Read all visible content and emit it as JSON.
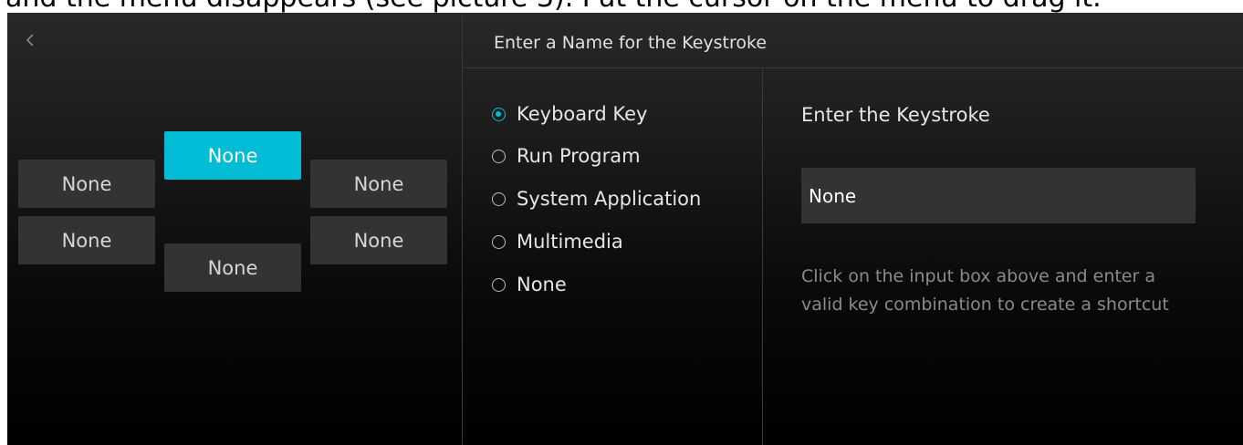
{
  "document": {
    "caption_fragment": "and the menu disappears (see picture 3). Put the cursor on the menu to drag it."
  },
  "left_panel": {
    "back_icon": "chevron-left-icon",
    "keys": [
      {
        "label": "None",
        "active": true
      },
      {
        "label": "None",
        "active": false
      },
      {
        "label": "None",
        "active": false
      },
      {
        "label": "None",
        "active": false
      },
      {
        "label": "None",
        "active": false
      },
      {
        "label": "None",
        "active": false
      }
    ]
  },
  "header": {
    "title": "Enter a Name for the Keystroke"
  },
  "function_types": {
    "selected": "Keyboard Key",
    "options": [
      {
        "label": "Keyboard Key",
        "checked": true
      },
      {
        "label": "Run Program",
        "checked": false
      },
      {
        "label": "System Application",
        "checked": false
      },
      {
        "label": "Multimedia",
        "checked": false
      },
      {
        "label": "None",
        "checked": false
      }
    ]
  },
  "keystroke": {
    "title": "Enter the Keystroke",
    "value": "None",
    "help": "Click on the input box above and enter a valid key combination to create a shortcut"
  },
  "colors": {
    "accent": "#00bcd4",
    "button_bg": "#333333",
    "panel_bg": "#1d1d1d",
    "help_text": "#8a8a8a"
  }
}
